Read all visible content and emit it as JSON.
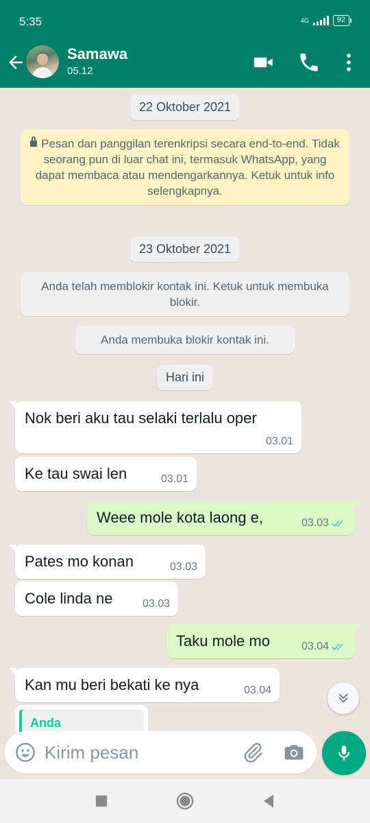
{
  "status_bar": {
    "time": "5:35",
    "network": "4G",
    "battery": "92"
  },
  "header": {
    "contact_name": "Samawa",
    "subtitle": "05.12"
  },
  "chat": {
    "date_1": "22 Oktober 2021",
    "encryption_notice": "Pesan dan panggilan terenkripsi secara end-to-end. Tidak seorang pun di luar chat ini, termasuk WhatsApp, yang dapat membaca atau mendengarkannya. Ketuk untuk info selengkapnya.",
    "date_2": "23 Oktober 2021",
    "blocked_notice": "Anda telah memblokir kontak ini. Ketuk untuk membuka blokir.",
    "unblocked_notice": "Anda membuka blokir kontak ini.",
    "date_3": "Hari ini",
    "messages": [
      {
        "direction": "in",
        "text": "Nok beri aku tau selaki terlalu oper",
        "time": "03.01"
      },
      {
        "direction": "in",
        "text": "Ke tau swai len",
        "time": "03.01"
      },
      {
        "direction": "out",
        "text": "Weee mole kota laong e,",
        "time": "03.03",
        "status": "read"
      },
      {
        "direction": "in",
        "text": "Pates mo konan",
        "time": "03.03"
      },
      {
        "direction": "in",
        "text": "Cole linda ne",
        "time": "03.03"
      },
      {
        "direction": "out",
        "text": "Taku mole mo",
        "time": "03.04",
        "status": "read"
      },
      {
        "direction": "in",
        "text": "Kan mu beri bekati ke nya",
        "time": "03.04"
      }
    ],
    "quoted_label": "Anda"
  },
  "composer": {
    "placeholder": "Kirim pesan"
  },
  "icons": {
    "back": "arrow-left-icon",
    "video": "video-call-icon",
    "call": "phone-icon",
    "menu": "more-vert-icon",
    "emoji": "emoji-icon",
    "attach": "paperclip-icon",
    "camera": "camera-icon",
    "mic": "mic-icon",
    "scroll": "chevron-double-down-icon"
  },
  "colors": {
    "header": "#008069",
    "incoming_bubble": "#ffffff",
    "outgoing_bubble": "#dcf8c6",
    "chat_background": "#ece5dd",
    "notice_yellow": "#fdf3c5",
    "mic_button": "#00a884",
    "read_ticks": "#53bdeb"
  }
}
